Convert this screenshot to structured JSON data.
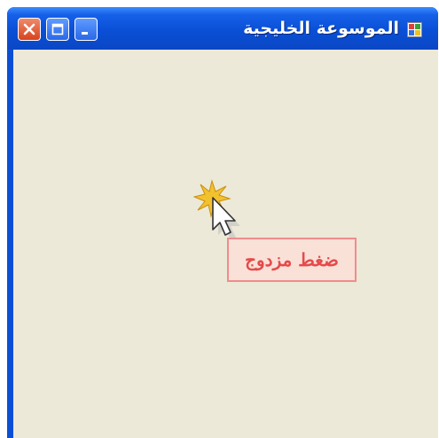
{
  "window": {
    "title": "الموسوعة الخليجية",
    "icons": {
      "app": "app-icon",
      "close": "close-icon",
      "maximize": "maximize-icon",
      "minimize": "minimize-icon"
    }
  },
  "content": {
    "cursor_icon": "arrow-cursor-icon",
    "click_effect_icon": "click-burst-icon",
    "tooltip_label": "ضغط مزدوج"
  },
  "colors": {
    "title_bar": "#0a4fd6",
    "client_background": "#ece9d8",
    "close_button": "#d8431d",
    "tooltip_border": "#f08c8c",
    "tooltip_text": "#e64a4a",
    "burst": "#f2c12e"
  }
}
